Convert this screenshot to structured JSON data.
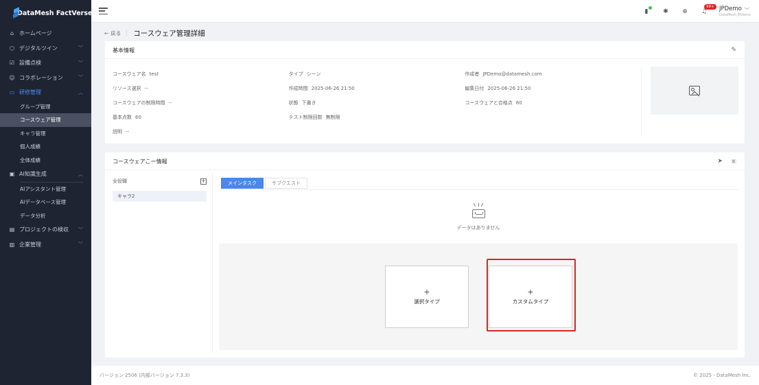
{
  "brand": {
    "name": "DataMesh FactVerse"
  },
  "sidebar": {
    "items": [
      {
        "label": "ホームページ",
        "icon": "home-icon",
        "chevron": ""
      },
      {
        "label": "デジタルツイン",
        "icon": "cube-icon",
        "chevron": "﹀"
      },
      {
        "label": "設備点検",
        "icon": "checklist-icon",
        "chevron": "﹀"
      },
      {
        "label": "コラボレーション",
        "icon": "users-icon",
        "chevron": "﹀"
      },
      {
        "label": "研修管理",
        "icon": "book-icon",
        "chevron": "︿"
      },
      {
        "label": "AI知識生成",
        "icon": "ai-icon",
        "chevron": "︿"
      },
      {
        "label": "プロジェクトの検収",
        "icon": "calendar-icon",
        "chevron": "﹀"
      },
      {
        "label": "企業管理",
        "icon": "building-icon",
        "chevron": "﹀"
      }
    ],
    "training_sub": [
      "グループ管理",
      "コースウェア管理",
      "キャラ管理",
      "個人成績",
      "全体成績"
    ],
    "ai_sub": [
      "AIアシスタント管理",
      "AIデータベース管理",
      "データ分析"
    ]
  },
  "header": {
    "user_name": "JPDemo",
    "user_sub": "DataMesh JPDemo",
    "notification_badge": "99+"
  },
  "page": {
    "back_label": "戻る",
    "title": "コースウェア管理詳細"
  },
  "basic_info": {
    "title": "基本情報",
    "rows": [
      [
        {
          "label": "コースウェア名",
          "value": "test"
        },
        {
          "label": "タイプ",
          "value": "シーン"
        },
        {
          "label": "作成者",
          "value": "JPDemo@datamesh.com"
        }
      ],
      [
        {
          "label": "リソース選択",
          "value": "--"
        },
        {
          "label": "作成時間",
          "value": "2025-06-26 21:50"
        },
        {
          "label": "編集日付",
          "value": "2025-06-26 21:50"
        }
      ],
      [
        {
          "label": "コースウェアの制限時間",
          "value": "--"
        },
        {
          "label": "状態",
          "value": "下書き"
        },
        {
          "label": "コースウェアと合格点",
          "value": "60"
        }
      ],
      [
        {
          "label": "基本点数",
          "value": "60"
        },
        {
          "label": "テスト制限回数",
          "value": "無制限"
        },
        {
          "label": "",
          "value": ""
        }
      ],
      [
        {
          "label": "説明",
          "value": "--"
        },
        {
          "label": "",
          "value": ""
        },
        {
          "label": "",
          "value": ""
        }
      ]
    ]
  },
  "course_info": {
    "title": "コースウェアこー情報",
    "left_header": "全役職",
    "roles": [
      "キャラ2"
    ],
    "tabs": [
      "メインタスク",
      "サブクエスト"
    ],
    "empty_text": "データはありません",
    "type_select": "選択タイプ",
    "type_custom": "カスタムタイプ",
    "plus": "+"
  },
  "footer": {
    "version": "バージョン 2506 (内部バージョン 7.3.3)",
    "copyright": "© 2025 - DataMesh Inc."
  },
  "colors": {
    "sidebar_bg": "#1f2433",
    "accent": "#4a88ea",
    "highlight": "#d9261c"
  }
}
